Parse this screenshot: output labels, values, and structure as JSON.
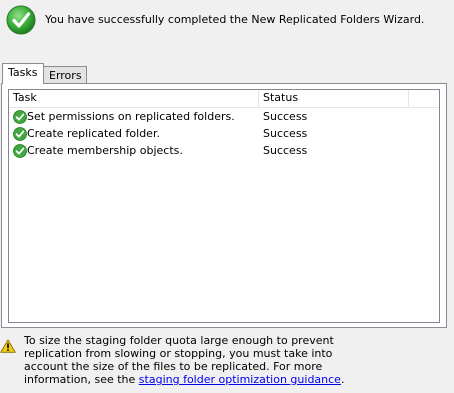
{
  "banner": {
    "icon": "success-check-icon",
    "message": "You have successfully completed the New Replicated Folders Wizard."
  },
  "tabs": [
    {
      "label": "Tasks",
      "active": true
    },
    {
      "label": "Errors",
      "active": false
    }
  ],
  "list": {
    "columns": [
      "Task",
      "Status"
    ],
    "rows": [
      {
        "icon": "success-check-icon",
        "task": "Set permissions on replicated folders.",
        "status": "Success"
      },
      {
        "icon": "success-check-icon",
        "task": "Create replicated folder.",
        "status": "Success"
      },
      {
        "icon": "success-check-icon",
        "task": "Create membership objects.",
        "status": "Success"
      }
    ]
  },
  "warning": {
    "icon": "warning-icon",
    "text": "To size the staging folder quota large enough to prevent replication from slowing or stopping, you must take into account the size of the files to be replicated. For more information, see the ",
    "link_text": "staging folder optimization guidance",
    "suffix": "."
  },
  "colors": {
    "success_green": "#3fa83f",
    "warning_yellow": "#f2c811",
    "link_blue": "#0000ee",
    "border_gray": "#898c95"
  }
}
